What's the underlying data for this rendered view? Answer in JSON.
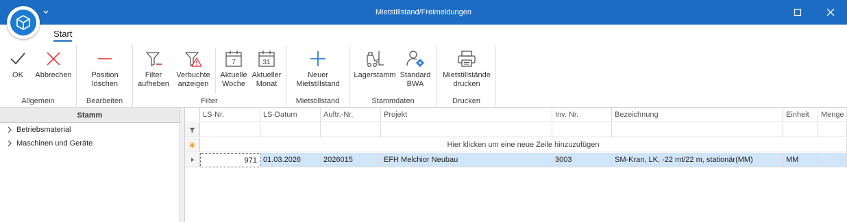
{
  "window": {
    "title": "Mietstillstand/Freimeldungen"
  },
  "ribbon": {
    "tab_start": "Start",
    "groups": {
      "allgemein": "Allgemein",
      "bearbeiten": "Bearbeiten",
      "filter": "Filter",
      "mietstillstand": "Mietstillstand",
      "stammdaten": "Stammdaten",
      "drucken": "Drucken"
    },
    "buttons": {
      "ok": "OK",
      "abbrechen": "Abbrechen",
      "position_loeschen": "Position\nlöschen",
      "filter_aufheben": "Filter\naufheben",
      "verbuchte_anzeigen": "Verbuchte\nanzeigen",
      "aktuelle_woche": "Aktuelle\nWoche",
      "aktueller_monat": "Aktueller\nMonat",
      "neuer_mietstillstand": "Neuer\nMietstillstand",
      "lagerstamm": "Lagerstamm",
      "standard_bwa": "Standard\nBWA",
      "drucken": "Mietstillstände\ndrucken"
    },
    "calendar_week_num": "7",
    "calendar_month_num": "31"
  },
  "left_panel": {
    "header": "Stamm",
    "items": [
      {
        "label": "Betriebsmaterial"
      },
      {
        "label": "Maschinen und Geräte"
      }
    ]
  },
  "grid": {
    "columns": [
      "LS-Nr.",
      "LS-Datum",
      "Auftr.-Nr.",
      "Projekt",
      "Inv. Nr.",
      "Bezeichnung",
      "Einheit",
      "Menge"
    ],
    "new_row_hint": "Hier klicken um eine neue Zeile hinzuzufügen",
    "rows": [
      {
        "ls_nr": "971",
        "ls_datum": "01.03.2026",
        "auftr_nr": "2026015",
        "projekt": "EFH Melchior Neubau",
        "inv_nr": "3003",
        "bezeichnung": "SM-Kran, LK, -22 mt/22 m, stationär(MM)",
        "einheit": "MM",
        "menge": ""
      }
    ]
  },
  "colors": {
    "titlebar": "#1d6cc4",
    "accent_red": "#e0454a",
    "accent_blue": "#2a7fd4",
    "selected_row": "#d0e5f8"
  }
}
